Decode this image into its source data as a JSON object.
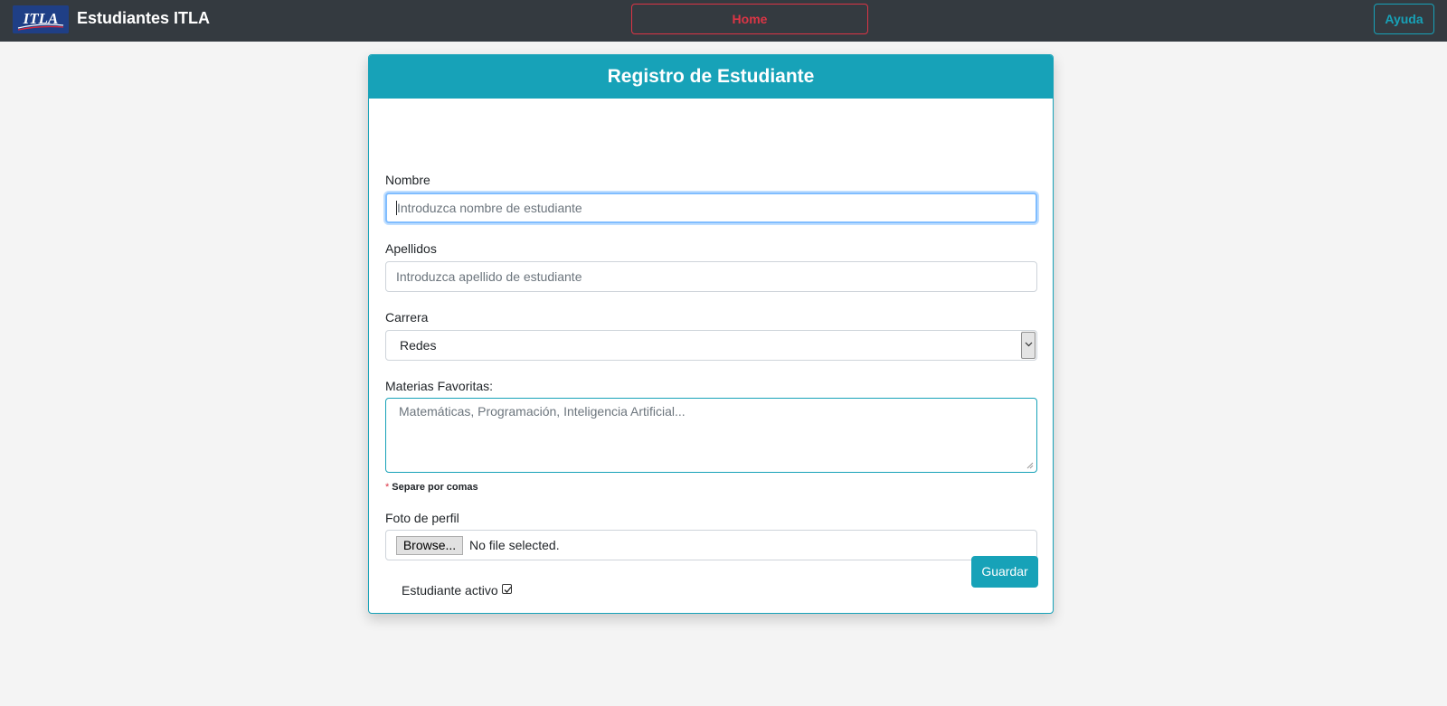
{
  "navbar": {
    "logo_text": "ITLA",
    "brand": "Estudiantes ITLA",
    "home_label": "Home",
    "help_label": "Ayuda"
  },
  "form": {
    "title": "Registro de Estudiante",
    "nombre": {
      "label": "Nombre",
      "placeholder": "Introduzca nombre de estudiante",
      "value": ""
    },
    "apellidos": {
      "label": "Apellidos",
      "placeholder": "Introduzca apellido de estudiante",
      "value": ""
    },
    "carrera": {
      "label": "Carrera",
      "selected": "Redes"
    },
    "materias": {
      "label": "Materias Favoritas:",
      "placeholder": "Matemáticas, Programación, Inteligencia Artificial...",
      "hint_star": "*",
      "hint": "Separe por comas"
    },
    "foto": {
      "label": "Foto de perfil",
      "browse_label": "Browse...",
      "status": "No file selected."
    },
    "activo": {
      "label": "Estudiante activo",
      "checked": true
    },
    "save_label": "Guardar"
  },
  "colors": {
    "navbar_bg": "#343a40",
    "accent": "#17a2b8",
    "danger": "#dc3545",
    "page_bg": "#f4f4f4"
  }
}
